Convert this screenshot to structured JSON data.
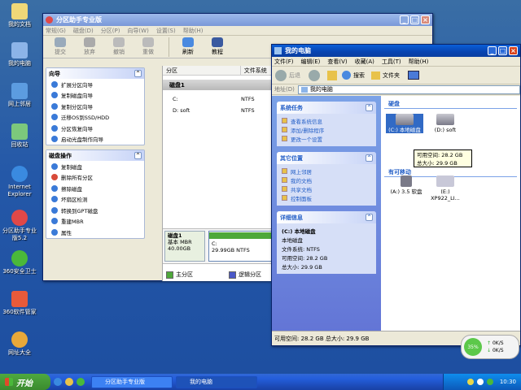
{
  "desktop": {
    "icons": [
      {
        "label": "我的文档",
        "icon": "my-documents-icon"
      },
      {
        "label": "我的电脑",
        "icon": "my-computer-icon"
      },
      {
        "label": "网上邻居",
        "icon": "network-places-icon"
      },
      {
        "label": "回收站",
        "icon": "recycle-bin-icon"
      },
      {
        "label": "Internet Explorer",
        "icon": "ie-icon"
      },
      {
        "label": "分区助手专业版5.2",
        "icon": "partition-assistant-icon"
      },
      {
        "label": "360安全卫士",
        "icon": "360-safeguard-icon"
      },
      {
        "label": "360软件管家",
        "icon": "360-software-icon"
      },
      {
        "label": "网址大全",
        "icon": "url-directory-icon"
      }
    ]
  },
  "pa": {
    "title": "分区助手专业版",
    "menu": [
      "常规(G)",
      "磁盘(D)",
      "分区(P)",
      "向导(W)",
      "设置(S)",
      "帮助(H)"
    ],
    "toolbar": [
      "提交",
      "放弃",
      "撤销",
      "重做",
      "刷新",
      "教程"
    ],
    "wizard": {
      "title": "向导",
      "items": [
        "扩展分区向导",
        "复制磁盘向导",
        "复制分区向导",
        "迁移OS到SSD/HDD",
        "分区恢复向导",
        "启动光盘制作向导"
      ]
    },
    "diskops": {
      "title": "磁盘操作",
      "items": [
        "复制磁盘",
        "删除所有分区",
        "擦除磁盘",
        "坏扇区检测",
        "转换到GPT磁盘",
        "重建MBR",
        "属性"
      ]
    },
    "columns": [
      "分区",
      "文件系统"
    ],
    "disk_label": "磁盘1",
    "partitions": [
      {
        "name": "C:",
        "fs": "NTFS"
      },
      {
        "name": "D: soft",
        "fs": "NTFS"
      }
    ],
    "map": {
      "disk": "磁盘1",
      "type": "基本 MBR",
      "size": "40.00GB",
      "part": "C:",
      "part_info": "29.99GB NTFS"
    },
    "legend": [
      "主分区",
      "逻辑分区"
    ]
  },
  "mc": {
    "title": "我的电脑",
    "menu": [
      "文件(F)",
      "编辑(E)",
      "查看(V)",
      "收藏(A)",
      "工具(T)",
      "帮助(H)"
    ],
    "back": "后退",
    "search": "搜索",
    "folders": "文件夹",
    "address_label": "地址(D)",
    "address": "我的电脑",
    "system_tasks": {
      "title": "系统任务",
      "items": [
        "查看系统信息",
        "添加/删除程序",
        "更改一个设置"
      ]
    },
    "other_places": {
      "title": "其它位置",
      "items": [
        "网上邻居",
        "我的文档",
        "共享文档",
        "控制面板"
      ]
    },
    "details": {
      "title": "详细信息",
      "name": "(C:) 本地磁盘",
      "type": "本地磁盘",
      "fs": "文件系统: NTFS",
      "free": "可用空间: 28.2 GB",
      "total": "总大小: 29.9 GB"
    },
    "group_hdd": "硬盘",
    "group_removable": "有可移动",
    "drives": [
      {
        "label": "(C:) 本地磁盘"
      },
      {
        "label": "(D:) soft"
      },
      {
        "label": "(A:) 3.5 软盘"
      },
      {
        "label": "(E:) XP922_LI..."
      }
    ],
    "tooltip": [
      "可用空间: 28.2 GB",
      "总大小: 29.9 GB"
    ],
    "status": "可用空间: 28.2 GB 总大小: 29.9 GB"
  },
  "netmon": {
    "percent": "35%",
    "up": "0K/S",
    "down": "0K/S"
  },
  "taskbar": {
    "start": "开始",
    "tasks": [
      "分区助手专业版",
      "我的电脑"
    ],
    "clock": "10:30"
  }
}
